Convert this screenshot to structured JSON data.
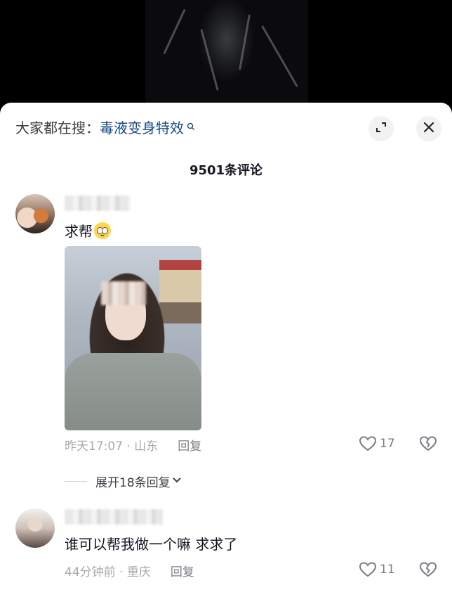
{
  "search_suggestion": {
    "prefix": "大家都在搜：",
    "keyword": "毒液变身特效"
  },
  "comment_count_label": "9501条评论",
  "comments": [
    {
      "text": "求帮",
      "time_location": "昨天17:07 · 山东",
      "reply_label": "回复",
      "like_count": "17",
      "expand_replies_label": "展开18条回复"
    },
    {
      "text": "谁可以帮我做一个嘛 求求了",
      "time_location": "44分钟前 · 重庆",
      "reply_label": "回复",
      "like_count": "11"
    }
  ],
  "icons": {
    "search_mini": "search-icon",
    "expand": "expand-icon",
    "close": "close-icon",
    "like": "heart-icon",
    "dislike": "broken-heart-icon",
    "chevron": "chevron-down-icon",
    "emoji": "pleading-face-emoji"
  },
  "colors": {
    "keyword": "#174a85",
    "meta_text": "#a7a9ae",
    "primary_text": "#161823"
  }
}
